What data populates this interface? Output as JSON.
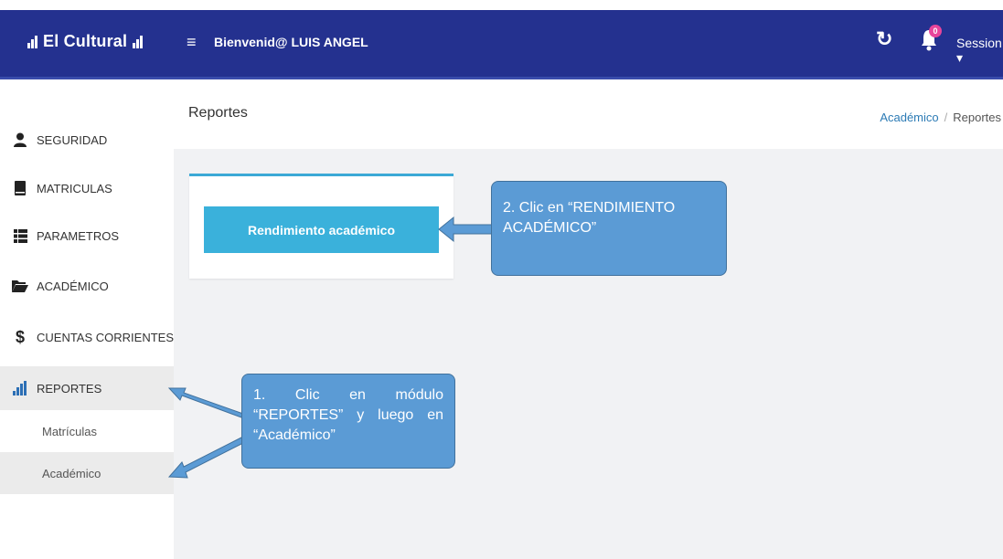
{
  "header": {
    "brand": "El Cultural",
    "welcome": "Bienvenid@ LUIS ANGEL",
    "notification_count": "0",
    "session_label": "Session",
    "colors": {
      "topbar": "#24318f",
      "badge": "#e8459b"
    }
  },
  "sidebar": {
    "items": [
      {
        "label": "SEGURIDAD",
        "icon": "user-icon"
      },
      {
        "label": "MATRICULAS",
        "icon": "book-icon"
      },
      {
        "label": "PARAMETROS",
        "icon": "list-icon"
      },
      {
        "label": "ACADÉMICO",
        "icon": "folder-open-icon"
      },
      {
        "label": "CUENTAS CORRIENTES",
        "icon": "dollar-icon"
      },
      {
        "label": "REPORTES",
        "icon": "bar-chart-icon",
        "active": true
      }
    ],
    "subitems": [
      {
        "label": "Matrículas"
      },
      {
        "label": "Académico"
      }
    ]
  },
  "main": {
    "title": "Reportes",
    "breadcrumb": {
      "link": "Académico",
      "separator": "/",
      "current": "Reportes"
    },
    "button_label": "Rendimiento académico",
    "accent": "#3ab1db"
  },
  "callouts": {
    "step1": "1. Clic en módulo “REPORTES” y luego en “Académico”",
    "step2": "2. Clic en “RENDIMIENTO ACADÉMICO”"
  }
}
